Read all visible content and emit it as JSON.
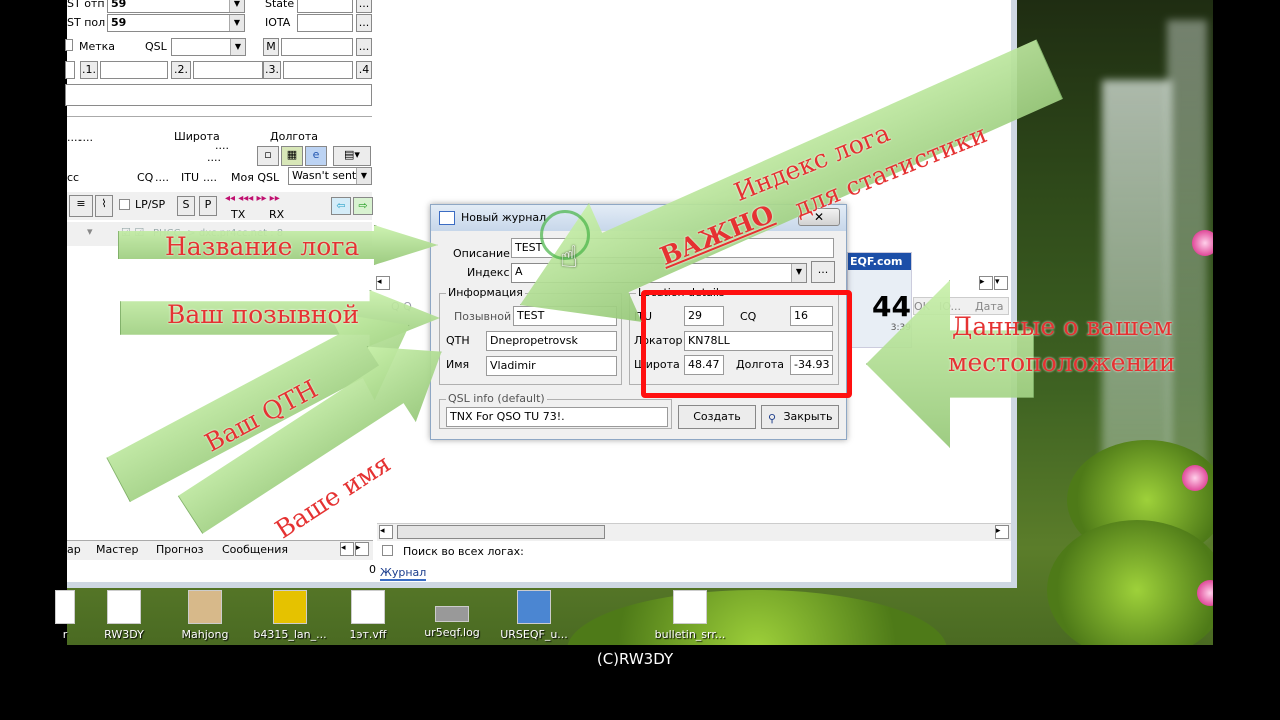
{
  "window": {
    "rst_sent_label": "ST отп",
    "rst_sent_value": "59",
    "rst_rcvd_label": "ST пол",
    "rst_rcvd_value": "59",
    "state_label": "State",
    "iota_label": "IOTA",
    "mark_label": "Метка",
    "qsl_label": "QSL",
    "m_label": "M",
    "slot1": ".1.",
    "slot2": ".2.",
    "slot3": ".3.",
    "slot4": ".4",
    "dots1": "....",
    "lat_label": "Широта",
    "lat_dots": "....",
    "lon_label": "Долгота",
    "lon_dots": "....",
    "dots3": "....",
    "cc_label": "cc",
    "cq_label": "CQ",
    "cq_dots": "....",
    "itu_label": "ITU",
    "itu_dots": "....",
    "my_qsl_label": "Моя QSL",
    "my_qsl_value": "Wasn't sent",
    "lp_sp": "LP/SP",
    "s_btn": "S",
    "p_btn": "P",
    "tx_label": "TX",
    "rx_label": "RX",
    "cluster_text": "PHCC -> dxc.pr4cc.net : 8",
    "banner": "EQF.com",
    "big_num": "44",
    "small_num": "3:39",
    "col_ok": "OK",
    "col_io": "IO...",
    "col_date": "Дата",
    "tabs": [
      "ар",
      "Мастер",
      "Прогноз",
      "Сообщения"
    ],
    "search_all_logs": "Поиск во всех логах:",
    "zero": "0",
    "journal_tab": "Журнал"
  },
  "dialog": {
    "title": "Новый журнал",
    "close": "✕",
    "description_label": "Описание",
    "description_value": "TEST",
    "index_label": "Индекс",
    "index_value": "A",
    "browse": "...",
    "info_group": "Информация",
    "callsign_label": "Позывной",
    "callsign_value": "TEST",
    "qth_label": "QTH",
    "qth_value": "Dnepropetrovsk",
    "name_label": "Имя",
    "name_value": "Vladimir",
    "location_group": "Location details",
    "itu_label": "ITU",
    "itu_value": "29",
    "cq_label": "CQ",
    "cq_value": "16",
    "locator_label": "Локатор",
    "locator_value": "KN78LL",
    "lat_label": "Широта",
    "lat_value": "48.47",
    "lon_label": "Долгота",
    "lon_value": "-34.93",
    "qsl_group": "QSL info (default)",
    "qsl_value": "TNX For QSO TU 73!.",
    "create_button": "Создать",
    "close_button": "Закрыть"
  },
  "annotations": {
    "log_index": "Индекс лога",
    "important": "ВАЖНО",
    "for_stats": "для статистики",
    "log_name": "Название лога",
    "your_call": "Ваш позывной",
    "your_qth": "Ваш QTH",
    "your_name": "Ваше имя",
    "location_data": "Данные о вашем",
    "location_data2": "местоположении"
  },
  "desktop_icons": [
    "r",
    "RW3DY",
    "Mahjong",
    "b4315_lan_...",
    "1эт.vff",
    "ur5eqf.log",
    "URSEQF_u...",
    "bulletin_srr..."
  ],
  "caption": "(C)RW3DY",
  "colors": {
    "annotation_red": "#e53232",
    "arrow_green": "#c8f0aa",
    "red_frame": "#ff1010"
  }
}
